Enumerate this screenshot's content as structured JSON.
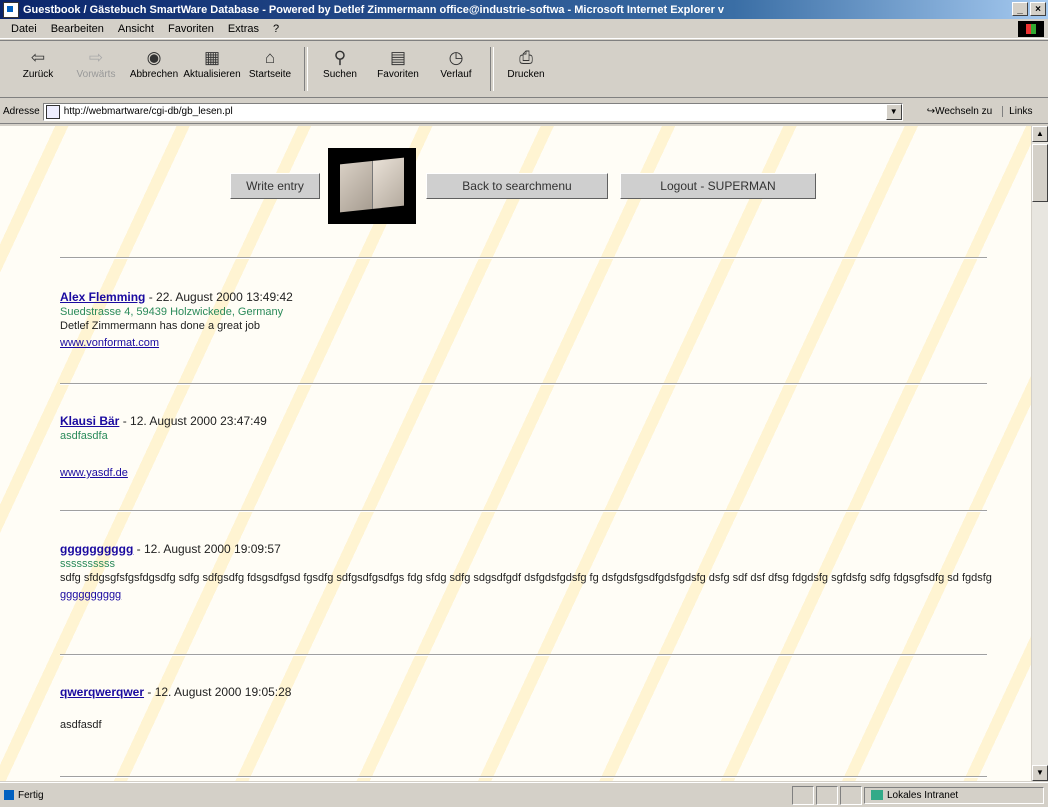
{
  "window": {
    "title": "Guestbook / Gästebuch SmartWare Database - Powered by Detlef Zimmermann office@industrie-softwa - Microsoft Internet Explorer v",
    "controls": [
      "_",
      "×"
    ]
  },
  "menu": [
    "Datei",
    "Bearbeiten",
    "Ansicht",
    "Favoriten",
    "Extras",
    "?"
  ],
  "toolbar": {
    "back": "Zurück",
    "forward": "Vorwärts",
    "stop": "Abbrechen",
    "refresh": "Aktualisieren",
    "home": "Startseite",
    "search": "Suchen",
    "favorites": "Favoriten",
    "history": "Verlauf",
    "print": "Drucken"
  },
  "address": {
    "label": "Adresse",
    "url": "http://webmartware/cgi-db/gb_lesen.pl",
    "go": "Wechseln zu",
    "links": "Links"
  },
  "page": {
    "buttons": {
      "write": "Write entry",
      "back": "Back to searchmenu",
      "logout": "Logout - SUPERMAN"
    },
    "entries": [
      {
        "name": "Alex Flemming",
        "date": " - 22. August 2000 13:49:42",
        "address": "Suedstrasse 4, 59439 Holzwickede, Germany",
        "message": "Detlef Zimmermann has done a great job",
        "url": "www.vonformat.com"
      },
      {
        "name": "Klausi Bär",
        "date": " - 12. August 2000 23:47:49",
        "address": "asdfasdfa",
        "message": "",
        "url": "www.yasdf.de"
      },
      {
        "name": "gggggggggg",
        "date": " - 12. August 2000 19:09:57",
        "address": "ssssssssss",
        "message": "sdfg sfdgsgfsfgsfdgsdfg sdfg sdfgsdfg fdsgsdfgsd fgsdfg sdfgsdfgsdfgs fdg sfdg sdfg sdgsdfgdf dsfgdsfgdsfg fg dsfgdsfgsdfgdsfgdsfg dsfg sdf dsf dfsg fdgdsfg sgfdsfg sdfg fdgsgfsdfg sd fgdsfg",
        "url": "gggggggggg"
      },
      {
        "name": "qwerqwerqwer",
        "date": " - 12. August 2000 19:05:28",
        "address": "",
        "message": "asdfasdf",
        "url": ""
      }
    ]
  },
  "status": {
    "text": "Fertig",
    "zone": "Lokales Intranet"
  }
}
